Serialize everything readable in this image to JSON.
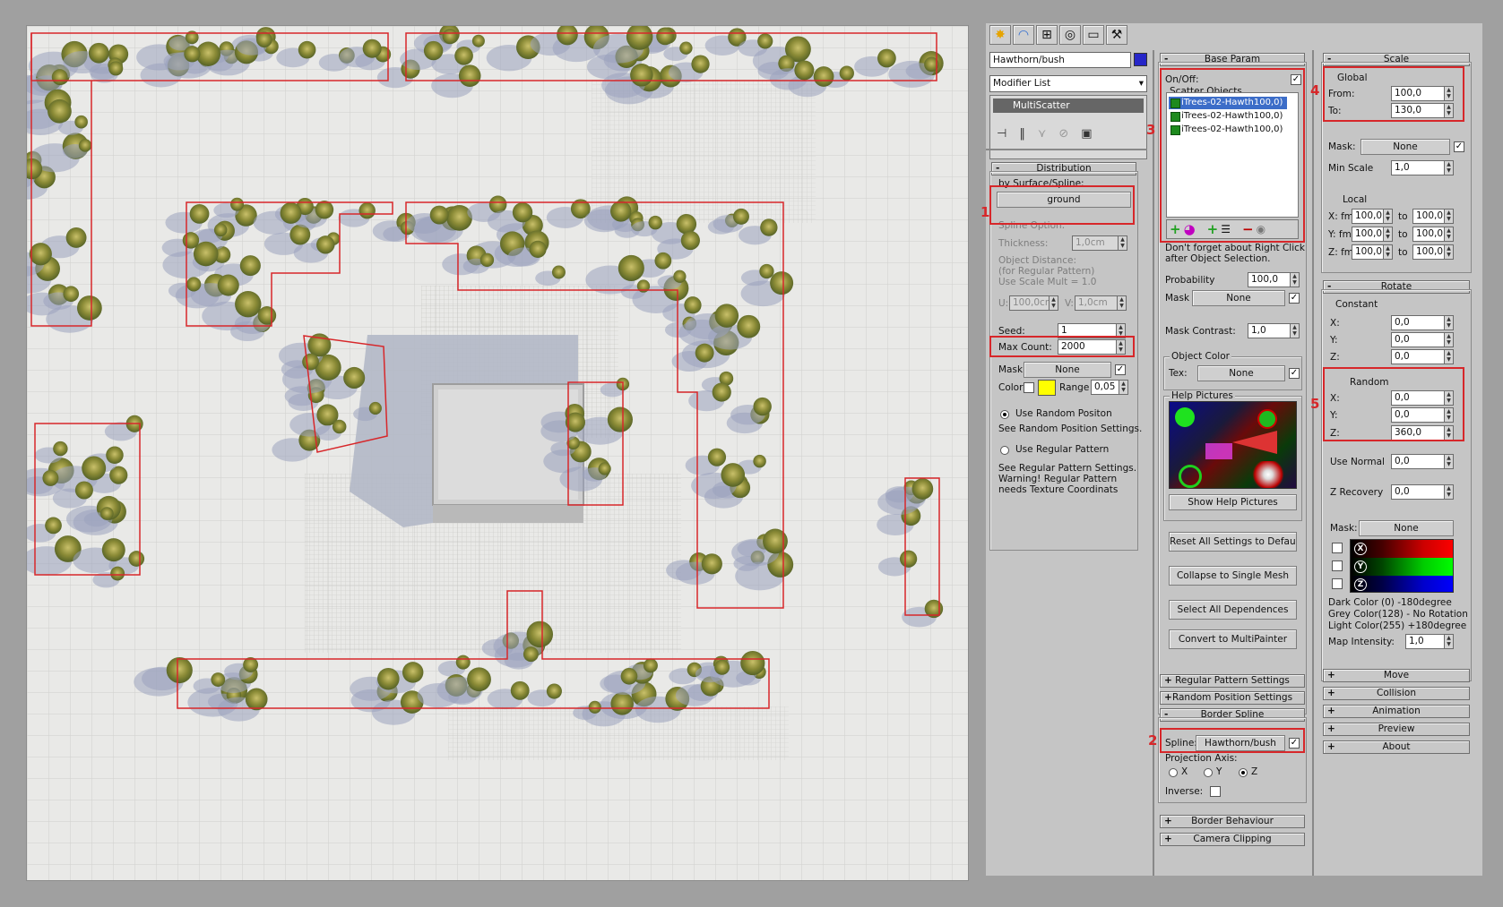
{
  "toolbar": {
    "tabs": [
      "create-icon",
      "modify-icon",
      "hierarchy-icon",
      "motion-icon",
      "display-icon",
      "utilities-icon"
    ]
  },
  "object": {
    "name": "Hawthorn/bush",
    "color": "#2626c8",
    "modifier_list": "Modifier List",
    "stack_item": "MultiScatter"
  },
  "distribution": {
    "header": "Distribution",
    "by_surface_label": "by Surface/Spline:",
    "surface_button": "ground",
    "spline_option": "Spline Option:",
    "thickness_label": "Thickness:",
    "thickness_value": "1,0cm",
    "object_distance": "Object Distance:",
    "regular_pattern_note": "(for Regular Pattern)",
    "use_scale_mult": "Use Scale Mult = 1.0",
    "u_label": "U:",
    "u_value": "100,0cn",
    "v_label": "V:",
    "v_value": "1,0cm",
    "seed_label": "Seed:",
    "seed_value": "1",
    "max_count_label": "Max Count:",
    "max_count_value": "2000",
    "mask_label": "Mask:",
    "mask_value": "None",
    "color_label": "Color",
    "color_swatch": "#ffff00",
    "range_label": "Range",
    "range_value": "0,05",
    "use_random": "Use Random Positon",
    "see_random": "See Random Position Settings.",
    "use_regular": "Use Regular Pattern",
    "see_regular": "See Regular Pattern Settings.",
    "warning_1": "Warning! Regular Pattern",
    "warning_2": "needs Texture Coordinats"
  },
  "base_param": {
    "header": "Base Param",
    "onoff_label": "On/Off:",
    "scatter_objects_label": "Scatter Objects",
    "objects": [
      "iTrees-02-Hawth100,0)",
      "iTrees-02-Hawth100,0)",
      "iTrees-02-Hawth100,0)"
    ],
    "hint_1": "Don't forget about Right Click",
    "hint_2": "after Object Selection.",
    "probability_label": "Probability",
    "probability_value": "100,0",
    "mask_label": "Mask",
    "mask_value": "None",
    "mask_contrast_label": "Mask Contrast:",
    "mask_contrast_value": "1,0",
    "object_color_label": "Object Color",
    "tex_label": "Tex:",
    "tex_value": "None",
    "help_pictures_label": "Help Pictures",
    "show_help_button": "Show Help Pictures",
    "reset_button": "Reset All Settings to Default",
    "collapse_button": "Collapse to Single Mesh",
    "select_button": "Select All Dependences",
    "convert_button": "Convert to MultiPainter"
  },
  "mid_rollouts": {
    "regular_pattern": "Regular Pattern Settings",
    "random_position": "Random Position Settings",
    "border_spline": "Border Spline",
    "spline_label": "Spline:",
    "spline_value": "Hawthorn/bush",
    "projection_axis": "Projection Axis:",
    "axis_x": "X",
    "axis_y": "Y",
    "axis_z": "Z",
    "inverse_label": "Inverse:",
    "border_behaviour": "Border Behaviour",
    "camera_clipping": "Camera Clipping"
  },
  "scale": {
    "header": "Scale",
    "global_label": "Global",
    "from_label": "From:",
    "from_value": "100,0",
    "to_label": "To:",
    "to_value": "130,0",
    "mask_label": "Mask:",
    "mask_value": "None",
    "min_scale_label": "Min Scale",
    "min_scale_value": "1,0",
    "local_label": "Local",
    "x_fm": "X: fm",
    "y_fm": "Y: fm",
    "z_fm": "Z: fm",
    "to_small": "to",
    "x_from": "100,0",
    "x_to": "100,0",
    "y_from": "100,0",
    "y_to": "100,0",
    "z_from": "100,0",
    "z_to": "100,0"
  },
  "rotate": {
    "header": "Rotate",
    "constant_label": "Constant",
    "x_label": "X:",
    "y_label": "Y:",
    "z_label": "Z:",
    "cx": "0,0",
    "cy": "0,0",
    "cz": "0,0",
    "random_label": "Random",
    "rx": "0,0",
    "ry": "0,0",
    "rz": "360,0",
    "use_normal_label": "Use Normal",
    "use_normal_value": "0,0",
    "z_recovery_label": "Z Recovery",
    "z_recovery_value": "0,0",
    "mask_label": "Mask:",
    "mask_value": "None",
    "dark_color": "Dark Color (0)   -180degree",
    "grey_color": "Grey Color(128) - No Rotation",
    "light_color": "Light Color(255)  +180degree",
    "map_intensity_label": "Map Intensity:",
    "map_intensity_value": "1,0"
  },
  "bottom_rollouts": {
    "move": "Move",
    "collision": "Collision",
    "animation": "Animation",
    "preview": "Preview",
    "about": "About"
  },
  "annotations": [
    "1",
    "2",
    "3",
    "4",
    "5"
  ]
}
